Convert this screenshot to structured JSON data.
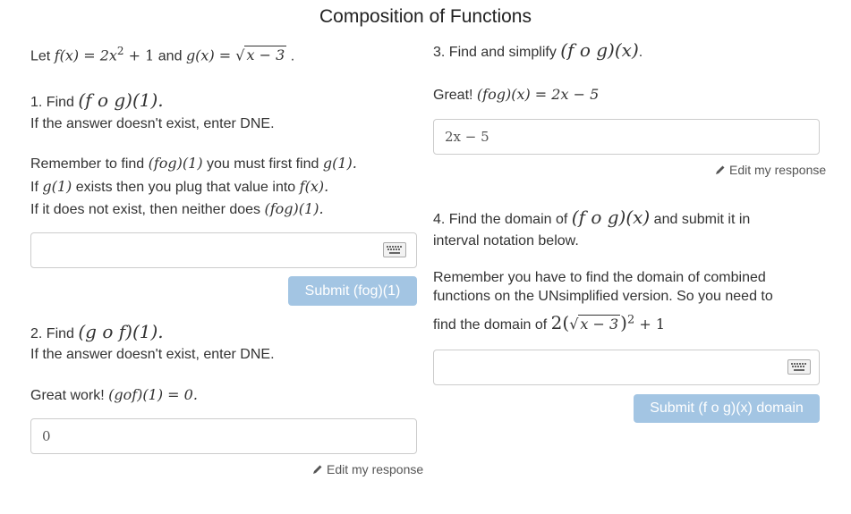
{
  "title": "Composition of Functions",
  "intro": {
    "let_word": "Let",
    "and_word": "and",
    "f_lhs": "f(x) = 2x",
    "f_sup": "2",
    "f_tail": " + 1",
    "g_lhs": "g(x) = ",
    "sqrt_sym": "√",
    "g_radicand": "x − 3",
    "period": "."
  },
  "q1": {
    "find_label": "1. Find",
    "expr": "(f o g)(1).",
    "hint_dne": "If the answer doesn't exist, enter DNE.",
    "remember_text": "Remember to find",
    "remember_expr": "(fog)(1)",
    "remember_tail": "you must first find",
    "remember_g1": "g(1).",
    "if_text": "If",
    "if_g1": "g(1)",
    "if_tail": "exists then you plug that value into",
    "if_fx": "f(x).",
    "not_text": "If it does not exist, then neither does",
    "not_expr": "(fog)(1).",
    "input_value": "",
    "submit_label": "Submit (fog)(1)"
  },
  "q2": {
    "find_label": "2. Find",
    "expr": "(g o f)(1).",
    "hint_dne": "If the answer doesn't exist, enter DNE.",
    "feedback": "Great work!",
    "feedback_expr": "(gof)(1) = 0.",
    "input_value": "0",
    "edit_label": "Edit my response"
  },
  "q3": {
    "prompt": "3. Find and simplify",
    "expr": "(f o g)(x)",
    "period": ".",
    "feedback": "Great!",
    "feedback_expr": "(fog)(x) = 2x − 5",
    "input_value": "2x − 5",
    "edit_label": "Edit my response"
  },
  "q4": {
    "prompt": "4. Find the domain of",
    "expr": "(f o g)(x)",
    "prompt_tail": "and submit it in",
    "prompt_line2": "interval notation below.",
    "remember_line1": "Remember you have to find the domain of combined",
    "remember_line2": "functions on the UNsimplified version.  So you need to",
    "remember_line3": "find the domain of",
    "domain_pre": "2(",
    "domain_radicand": "x − 3",
    "domain_post": ")",
    "domain_sup": "2",
    "domain_tail": " + 1",
    "input_value": "",
    "submit_label": "Submit (f o g)(x) domain"
  },
  "icons": {
    "keyboard": "keyboard-icon",
    "pencil": "pencil-icon"
  },
  "colors": {
    "button_bg": "#a3c5e3",
    "button_text": "#ffffff",
    "input_border": "#cccccc"
  }
}
